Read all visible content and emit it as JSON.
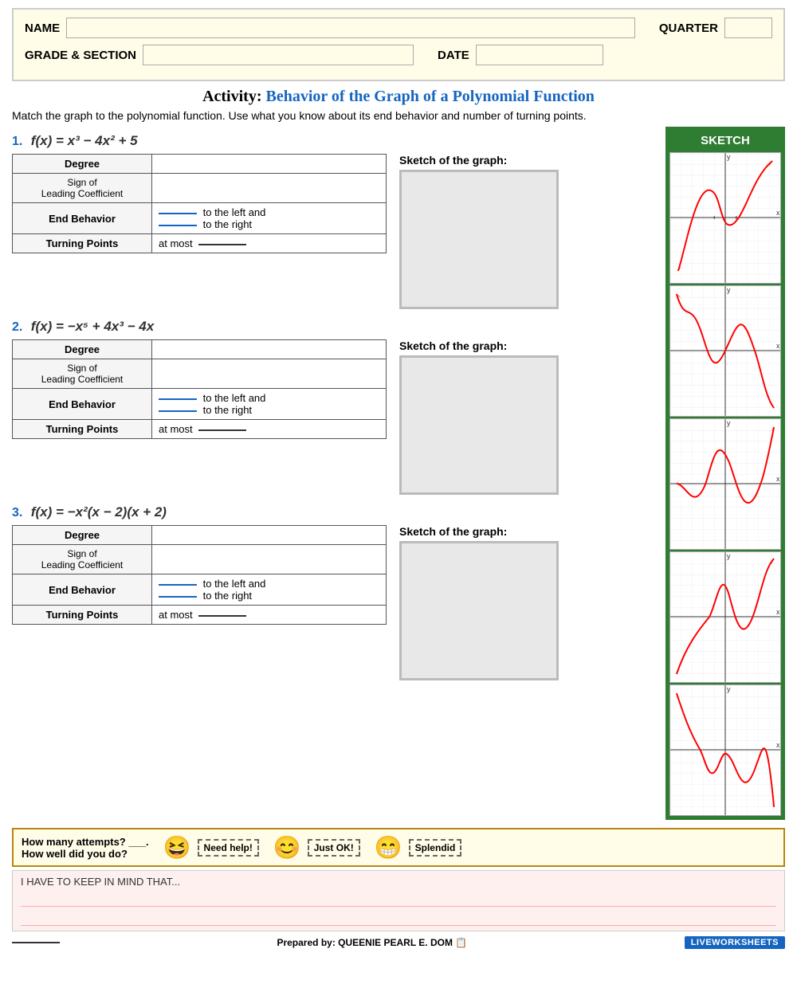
{
  "header": {
    "name_label": "NAME",
    "quarter_label": "QUARTER",
    "grade_label": "GRADE & SECTION",
    "date_label": "DATE"
  },
  "title": {
    "activity_prefix": "Activity:",
    "activity_main": "Behavior of the Graph of a Polynomial Function",
    "instructions": "Match the graph to the polynomial function. Use what you know about its end behavior and number of turning points."
  },
  "sidebar": {
    "sketch_label": "SKETCH"
  },
  "problems": [
    {
      "number": "1.",
      "formula": "f(x) = x³ − 4x² + 5",
      "formula_html": "f(x) = x³ − 4x² + 5",
      "table": {
        "rows": [
          {
            "label": "Degree",
            "label_type": "bold",
            "value": ""
          },
          {
            "label": "Sign of\nLeading Coefficient",
            "label_type": "small",
            "value": ""
          },
          {
            "label": "End Behavior",
            "label_type": "bold",
            "value": "end_behavior"
          },
          {
            "label": "Turning Points",
            "label_type": "bold",
            "value": "turning_points"
          }
        ]
      },
      "sketch_label": "Sketch of the graph:"
    },
    {
      "number": "2.",
      "formula": "f(x) = −x⁵ + 4x³ − 4x",
      "table": {
        "rows": [
          {
            "label": "Degree",
            "label_type": "bold",
            "value": ""
          },
          {
            "label": "Sign of\nLeading Coefficient",
            "label_type": "small",
            "value": ""
          },
          {
            "label": "End Behavior",
            "label_type": "bold",
            "value": "end_behavior"
          },
          {
            "label": "Turning Points",
            "label_type": "bold",
            "value": "turning_points"
          }
        ]
      },
      "sketch_label": "Sketch of the graph:"
    },
    {
      "number": "3.",
      "formula": "f(x) = −x²(x − 2)(x + 2)",
      "table": {
        "rows": [
          {
            "label": "Degree",
            "label_type": "bold",
            "value": ""
          },
          {
            "label": "Sign of\nLeading Coefficient",
            "label_type": "small",
            "value": ""
          },
          {
            "label": "End Behavior",
            "label_type": "bold",
            "value": "end_behavior"
          },
          {
            "label": "Turning Points",
            "label_type": "bold",
            "value": "turning_points"
          }
        ]
      },
      "sketch_label": "Sketch of the graph:"
    }
  ],
  "footer": {
    "attempts_text": "How many attempts? ___.",
    "well_text": "How well did you do?",
    "need_help": "Need help!",
    "just_ok": "Just OK!",
    "splendid": "Splendid"
  },
  "mindnote": {
    "text": "I HAVE TO KEEP IN MIND THAT..."
  },
  "credits": {
    "prepared_by": "Prepared by: QUEENIE PEARL E. DOM",
    "brand": "LIVEWORKSHEETS"
  }
}
